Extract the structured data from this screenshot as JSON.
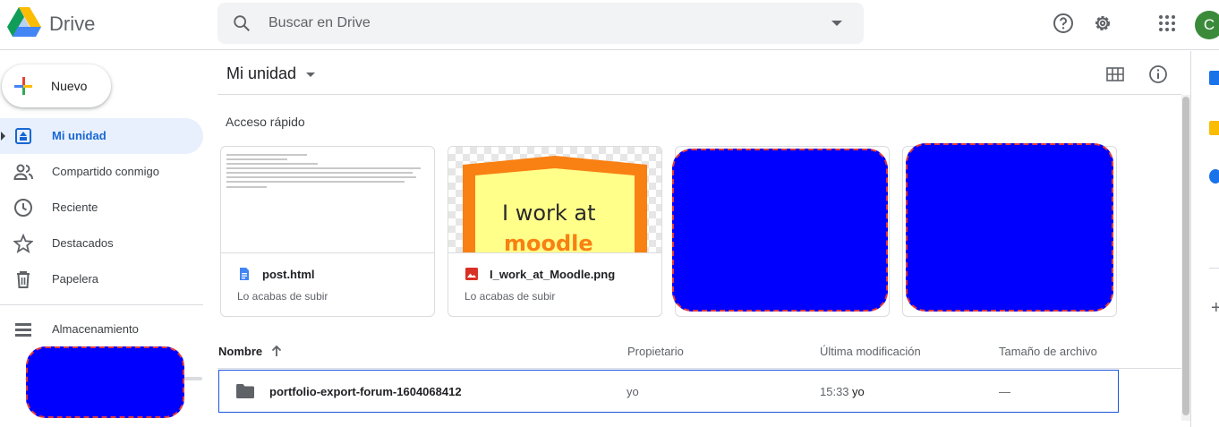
{
  "header": {
    "app_name": "Drive",
    "search_placeholder": "Buscar en Drive",
    "avatar_initial": "C"
  },
  "sidebar": {
    "new_label": "Nuevo",
    "items": [
      {
        "label": "Mi unidad",
        "icon": "my-drive-icon",
        "active": true
      },
      {
        "label": "Compartido conmigo",
        "icon": "people-icon"
      },
      {
        "label": "Reciente",
        "icon": "clock-icon"
      },
      {
        "label": "Destacados",
        "icon": "star-icon"
      },
      {
        "label": "Papelera",
        "icon": "trash-icon"
      }
    ],
    "storage_label": "Almacenamiento"
  },
  "main": {
    "title": "Mi unidad",
    "quick_access_label": "Acceso rápido",
    "cards": [
      {
        "name": "post.html",
        "subtitle": "Lo acabas de subir",
        "icon": "doc-icon"
      },
      {
        "name": "I_work_at_Moodle.png",
        "subtitle": "Lo acabas de subir",
        "icon": "image-icon",
        "preview_line1": "I work at",
        "preview_line2": "moodle"
      }
    ],
    "table": {
      "headers": [
        "Nombre",
        "Propietario",
        "Última modificación",
        "Tamaño de archivo"
      ],
      "rows": [
        {
          "name": "portfolio-export-forum-1604068412",
          "owner": "yo",
          "modified": "15:33",
          "modified_by": "yo",
          "size": "—"
        }
      ]
    }
  },
  "colors": {
    "accent": "#1967d2",
    "active_bg": "#e8f0fe",
    "redaction": "#0000ff"
  }
}
